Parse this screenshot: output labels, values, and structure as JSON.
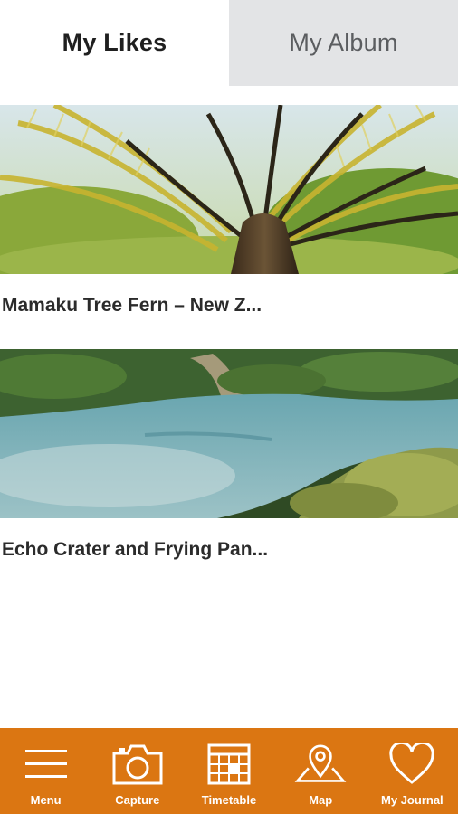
{
  "tabs": [
    {
      "label": "My Likes",
      "active": true
    },
    {
      "label": "My Album",
      "active": false
    }
  ],
  "likes": [
    {
      "title": "Mamaku Tree Fern – New Z...",
      "image": "tree-fern-photo"
    },
    {
      "title": "Echo Crater and Frying Pan...",
      "image": "crater-lake-photo"
    }
  ],
  "bottom_nav": {
    "items": [
      {
        "label": "Menu",
        "icon": "menu-icon"
      },
      {
        "label": "Capture",
        "icon": "camera-icon"
      },
      {
        "label": "Timetable",
        "icon": "calendar-icon"
      },
      {
        "label": "Map",
        "icon": "map-pin-icon"
      },
      {
        "label": "My Journal",
        "icon": "heart-icon"
      }
    ]
  },
  "colors": {
    "accent": "#db7612",
    "tab_inactive_bg": "#e3e4e6",
    "text_dark": "#2b2b2b"
  }
}
